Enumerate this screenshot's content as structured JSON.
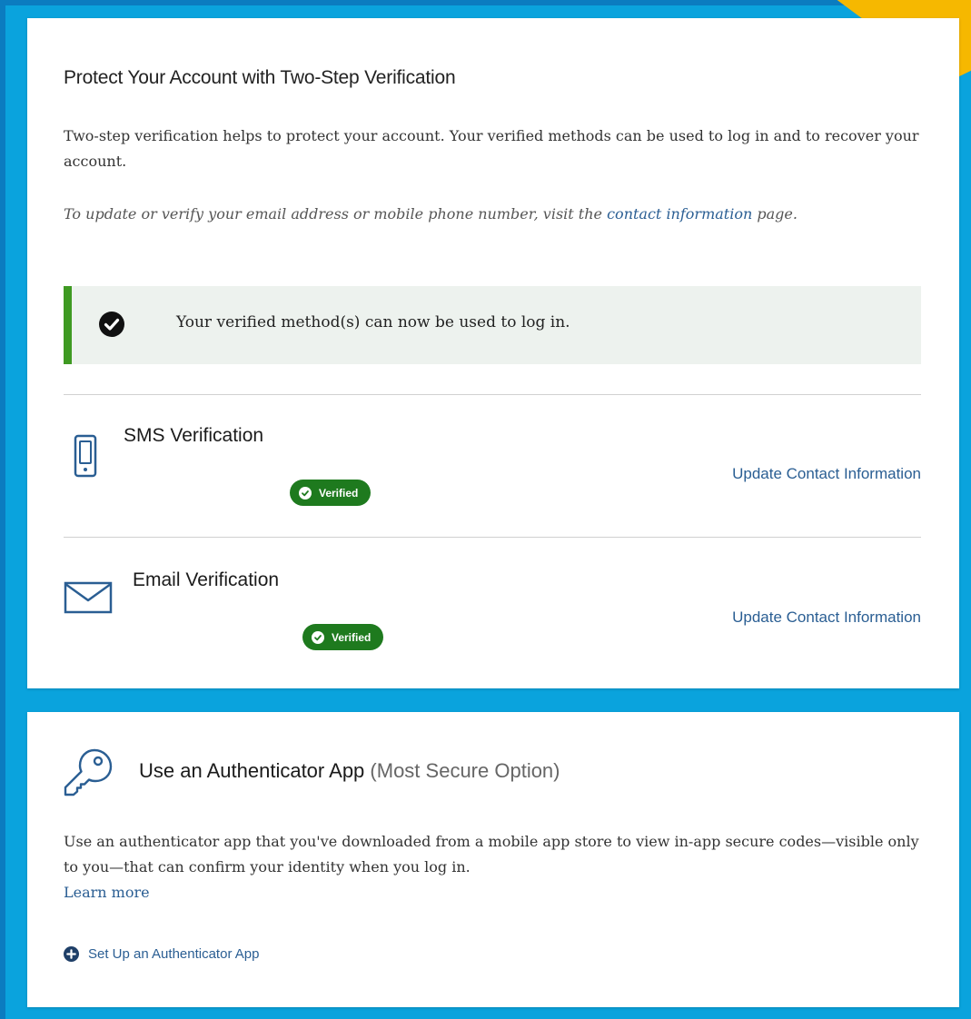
{
  "colors": {
    "accent_link": "#2a5e93",
    "success_green": "#3f9a22",
    "badge_green": "#1e7a1e",
    "alert_bg": "#edf2ee",
    "backdrop_blue": "#0aa3dd",
    "highlight_yellow": "#f6b800"
  },
  "two_step": {
    "title": "Protect Your Account with Two-Step Verification",
    "intro": "Two-step verification helps to protect your account. Your verified methods can be used to log in and to recover your account.",
    "note_prefix": "To update or verify your email address or mobile phone number, visit the ",
    "note_link": "contact information",
    "note_suffix": " page.",
    "alert": {
      "icon": "check-circle-icon",
      "text": "Your verified method(s) can now be used to log in."
    },
    "methods": [
      {
        "icon": "mobile-phone-icon",
        "title": "SMS Verification",
        "status": "Verified",
        "action": "Update Contact Information"
      },
      {
        "icon": "envelope-icon",
        "title": "Email Verification",
        "status": "Verified",
        "action": "Update Contact Information"
      }
    ]
  },
  "authenticator": {
    "icon": "key-icon",
    "title": "Use an Authenticator App",
    "subtitle": "(Most Secure Option)",
    "description": "Use an authenticator app that you've downloaded from a mobile app store to view in-app secure codes—visible only to you—that can confirm your identity when you log in.",
    "learn_more": "Learn more",
    "setup_icon": "plus-circle-icon",
    "setup_label": "Set Up an Authenticator App"
  }
}
